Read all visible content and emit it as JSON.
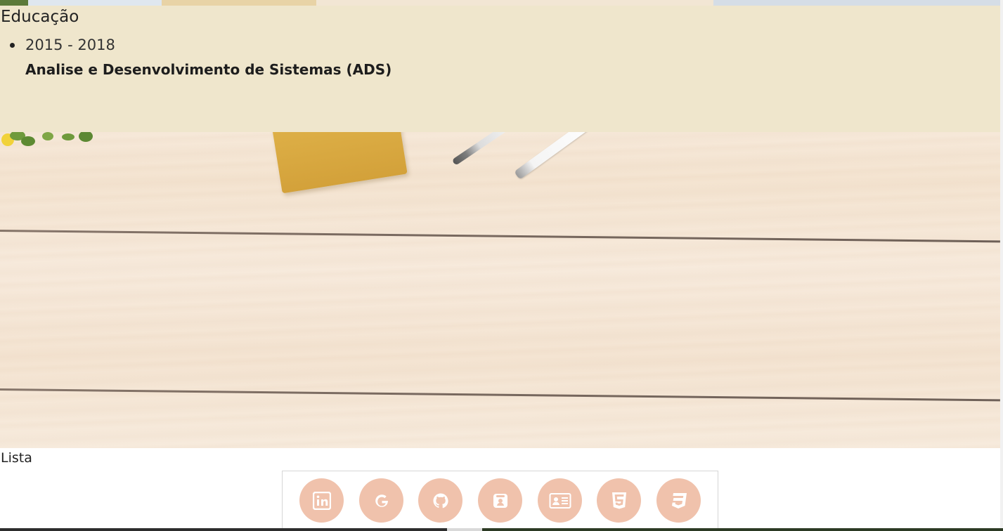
{
  "education": {
    "title": "Educação",
    "items": [
      {
        "period": "2015 - 2018",
        "course": "Analise e Desenvolvimento de Sistemas (ADS)"
      }
    ]
  },
  "lista": {
    "label": "Lista"
  },
  "social_icons": [
    {
      "name": "linkedin-icon"
    },
    {
      "name": "google-icon"
    },
    {
      "name": "github-icon"
    },
    {
      "name": "badge-icon"
    },
    {
      "name": "contact-card-icon"
    },
    {
      "name": "html5-icon"
    },
    {
      "name": "css3-icon"
    }
  ],
  "colors": {
    "education_bg": "#efe6cc",
    "icon_circle": "#f0c2ac",
    "icon_glyph": "#ffffff"
  }
}
